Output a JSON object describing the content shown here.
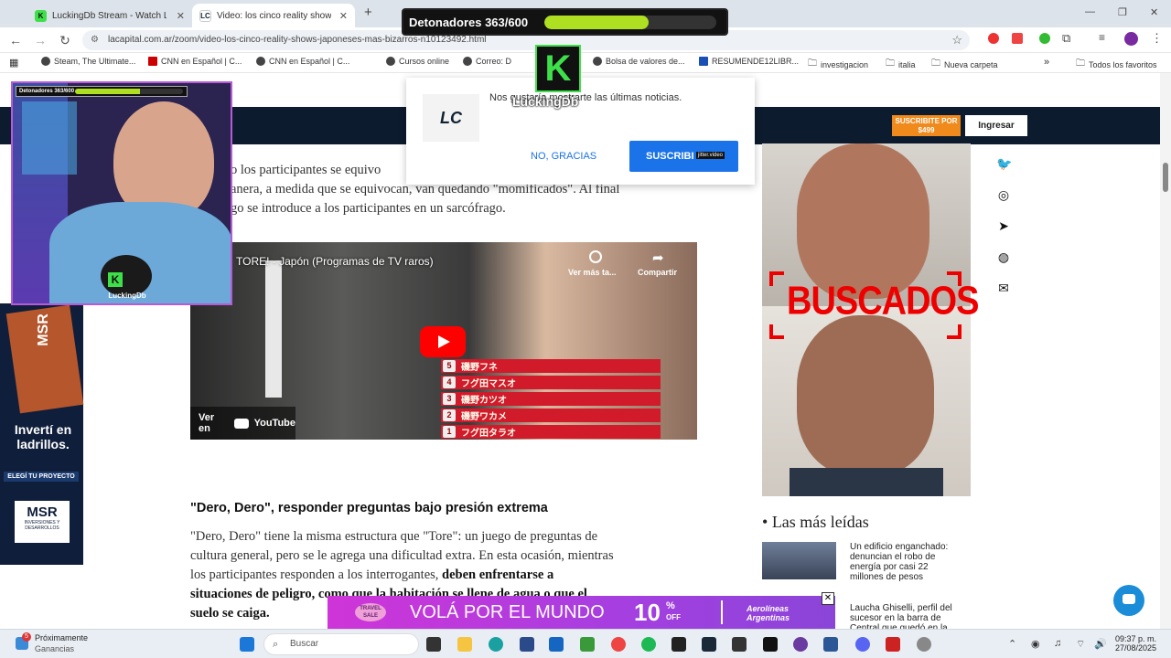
{
  "tabs": [
    {
      "label": "LuckingDb Stream - Watch Live",
      "active": false
    },
    {
      "label": "Video: los cinco reality shows ja",
      "active": true
    }
  ],
  "new_tab_label": "+",
  "window_controls": {
    "minimize": "—",
    "restore": "❐",
    "close": "✕"
  },
  "address": {
    "url": "lacapital.com.ar/zoom/video-los-cinco-reality-shows-japoneses-mas-bizarros-n10123492.html"
  },
  "bookmarks": [
    "Steam, The Ultimate...",
    "CNN en Español | C...",
    "CNN en Español | C...",
    "Cursos online",
    "Correo: D",
    "Bolsa de valores de...",
    "RESUMENDE12LIBR...",
    "investigacion",
    "italia",
    "Nueva carpeta"
  ],
  "bookmarks_all": "Todos los favoritos",
  "site": {
    "subscribe": "SUSCRIBITE POR $499",
    "login": "Ingresar"
  },
  "popup": {
    "logo": "LC",
    "message": "Nos gustaría mostrarte las últimas noticias.",
    "no_label": "NO, GRACIAS",
    "yes_label": "SUSCRIBI",
    "tag": "jitter.video"
  },
  "article": {
    "para1_l1": "o los participantes se equivo",
    "para1_l2": "anera, a medida que se equivocan, van quedando \"momificados\". Al final",
    "para1_l3": "go se introduce a los participantes en un sarcófrago.",
    "heading": "\"Dero, Dero\", responder preguntas bajo presión extrema",
    "para2_l1": "\"Dero, Dero\" tiene la misma estructura que \"Tore\": un juego de preguntas de",
    "para2_l2": "cultura general, pero se le agrega una dificultad extra. En esta ocasión, mientras",
    "para2_l3a": "los participantes responden a los interrogantes, ",
    "para2_l3b": "deben enfrentarse a",
    "para2_l4": "situaciones de peligro, como que la habitación se llene de agua o que el",
    "para2_l5": "suelo se caiga."
  },
  "video": {
    "title": "TORE! - Japón (Programas de TV raros)",
    "watch_later": "Ver más ta...",
    "share": "Compartir",
    "watch_on": "Ver en",
    "youtube": "YouTube",
    "ranks": [
      {
        "n": "5",
        "name": "磯野フネ"
      },
      {
        "n": "4",
        "name": "フグ田マスオ"
      },
      {
        "n": "3",
        "name": "磯野カツオ"
      },
      {
        "n": "2",
        "name": "磯野ワカメ"
      },
      {
        "n": "1",
        "name": "フグ田タラオ"
      }
    ]
  },
  "sidebar": {
    "wanted_text": "BUSCADOS",
    "mas_leidas": "Las más leídas",
    "news": [
      "Un edificio enganchado: denuncian el robo de energía por casi 22 millones de pesos",
      "Laucha Ghiselli, perfil del sucesor en la barra de Central que quedó en la"
    ]
  },
  "left_ad": {
    "brand": "MSR",
    "headline": "Invertí en ladrillos.",
    "cta": "ELEGÍ TU PROYECTO",
    "logo": "MSR",
    "logo_sub": "INVERSIONES Y DESARROLLOS"
  },
  "stream": {
    "hud_label": "Detonadores 363/600",
    "progress": 0.605,
    "mini_label": "Detonadores 363/600",
    "brand_letter": "K",
    "brand_name": "LuckingDb"
  },
  "banner": {
    "sale": "TRAVEL SALE",
    "text": "VOLÁ POR EL MUNDO",
    "pct": "10",
    "pct_sym": "%",
    "off": "OFF",
    "airline": "Aerolíneas Argentinas"
  },
  "taskbar": {
    "notif_count": "5",
    "notif_title": "Próximamente",
    "notif_sub": "Ganancias",
    "search": "Buscar",
    "time": "09:37 p. m.",
    "date": "27/08/2025"
  },
  "colors": {
    "accent": "#1a73e8",
    "site_header": "#0d1b2e",
    "progress": "#aee021",
    "kick": "#3ee04a"
  }
}
